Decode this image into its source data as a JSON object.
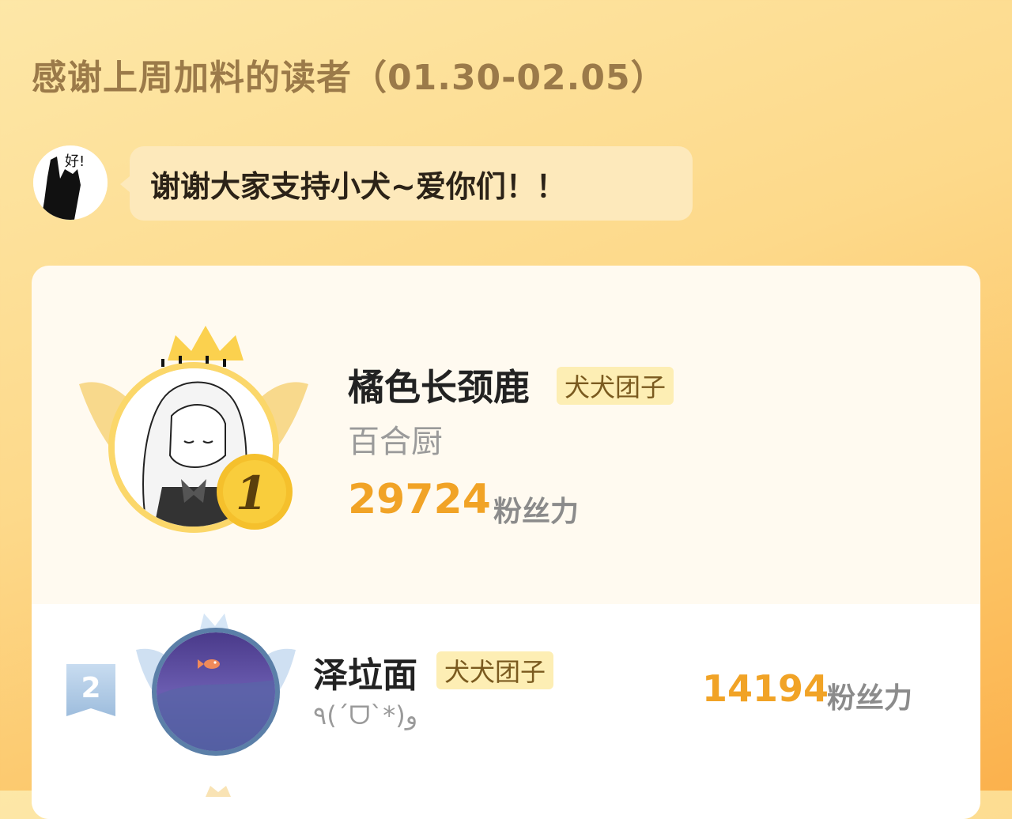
{
  "header": {
    "title": "感谢上周加料的读者（01.30-02.05）"
  },
  "message": {
    "avatar_icon": "author-avatar-icon",
    "avatar_text": "好!",
    "text": "谢谢大家支持小犬~爱你们！！"
  },
  "colors": {
    "accent": "#f1a326",
    "title": "#9b7a49",
    "badge_bg": "#fdeeb4",
    "badge_text": "#7a5a1f"
  },
  "leaderboard": {
    "entries": [
      {
        "rank": "1",
        "name": "橘色长颈鹿",
        "badge": "犬犬团子",
        "subtitle": "百合厨",
        "score": "29724",
        "unit": "粉丝力",
        "avatar_icon": "anime-girl-avatar-icon",
        "frame_icon": "gold-crown-wings-icon"
      },
      {
        "rank": "2",
        "name": "泽垃面",
        "badge": "犬犬团子",
        "subtitle": "٩(ˊᗜˋ*)و",
        "score": "14194",
        "unit": "粉丝力",
        "avatar_icon": "fish-night-avatar-icon",
        "frame_icon": "silver-crown-wings-icon"
      }
    ]
  }
}
